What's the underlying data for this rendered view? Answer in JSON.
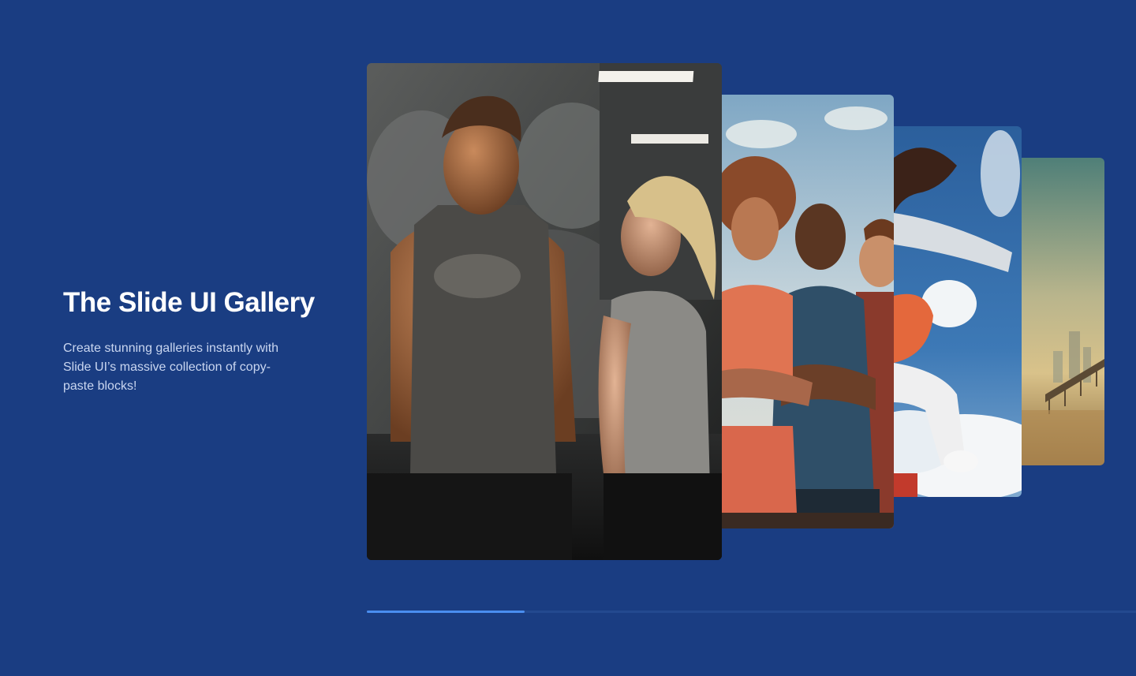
{
  "hero": {
    "title": "The Slide UI Gallery",
    "description": "Create stunning galleries instantly with Slide UI’s massive collection of copy-paste blocks!"
  },
  "slides": [
    {
      "name": "gym-couple-photo",
      "active": true
    },
    {
      "name": "athletes-group-photo",
      "active": false
    },
    {
      "name": "jumping-athlete-sky-photo",
      "active": false
    },
    {
      "name": "city-bridge-sunset-photo",
      "active": false
    }
  ],
  "progress": {
    "value_percent": 20.5
  },
  "colors": {
    "background": "#1a3d82",
    "accent": "#4a8ef0",
    "track": "#23498f",
    "text": "#ffffff",
    "muted_text": "#c9d6f0"
  }
}
